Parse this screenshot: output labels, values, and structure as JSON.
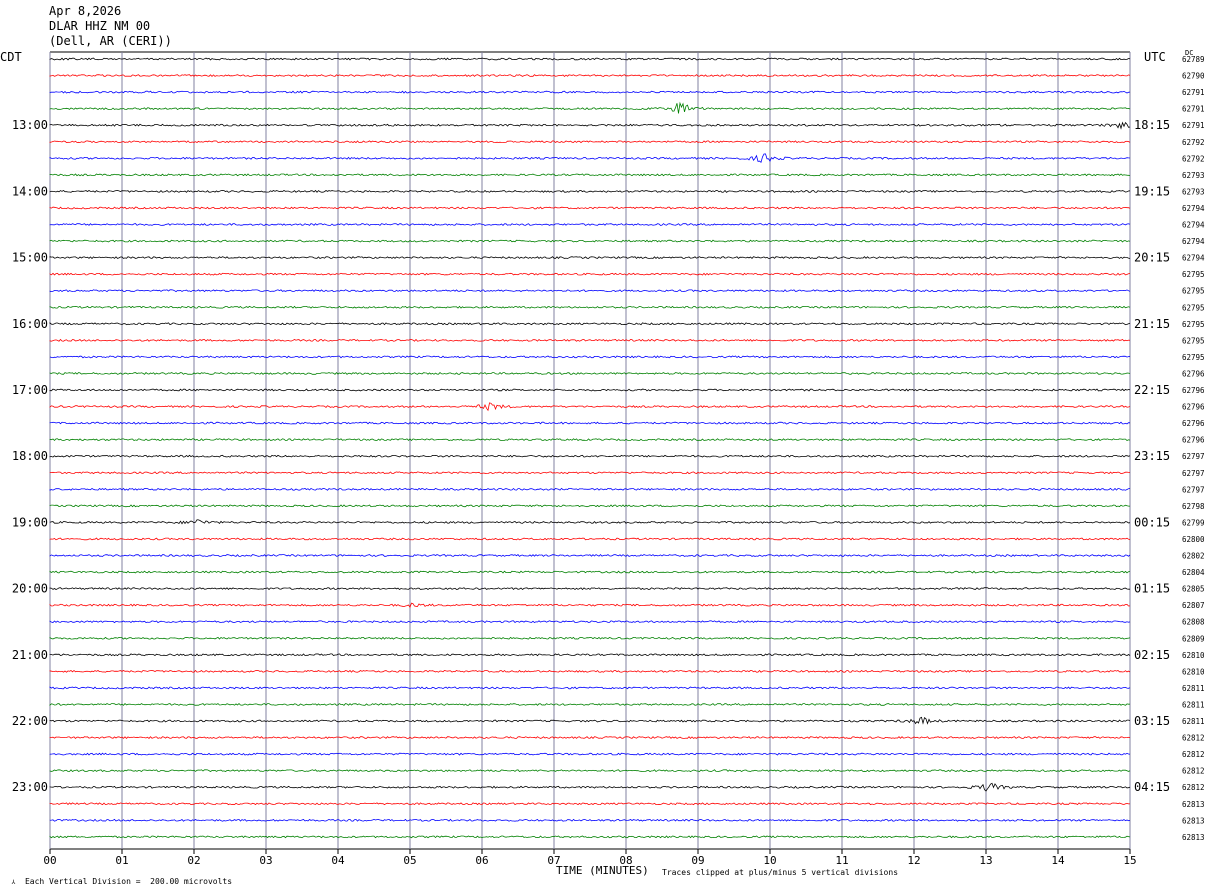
{
  "header": {
    "date": "Apr 8,2026",
    "station": "DLAR HHZ NM 00",
    "location": "(Dell, AR (CERI))"
  },
  "axes": {
    "left_label": "CDT",
    "right_label": "UTC",
    "dc_label": "DC",
    "x_title": "TIME (MINUTES)"
  },
  "footer": {
    "scale_text": "Each Vertical Division =  200.00 microvolts",
    "clip_text": "Traces clipped at plus/minus 5 vertical divisions"
  },
  "colors": {
    "trace_cycle": [
      "#000000",
      "#ff0000",
      "#0000ff",
      "#008000"
    ],
    "gridline": "#8080a0"
  },
  "chart_data": {
    "type": "line",
    "title": "",
    "xlabel": "TIME (MINUTES)",
    "xlim": [
      0,
      15
    ],
    "x_ticks": [
      "00",
      "01",
      "02",
      "03",
      "04",
      "05",
      "06",
      "07",
      "08",
      "09",
      "10",
      "11",
      "12",
      "13",
      "14",
      "15"
    ],
    "row_minutes": 15,
    "rows": 48,
    "left_time_labels": [
      "13:00",
      "14:00",
      "15:00",
      "16:00",
      "17:00",
      "18:00",
      "19:00",
      "20:00",
      "21:00",
      "22:00",
      "23:00"
    ],
    "right_time_labels": [
      "18:15",
      "19:15",
      "20:15",
      "21:15",
      "22:15",
      "23:15",
      "00:15",
      "01:15",
      "02:15",
      "03:15",
      "04:15"
    ],
    "hour_label_first_row": 4,
    "dc_offsets": [
      "62789",
      "62790",
      "62791",
      "62791",
      "62791",
      "62792",
      "62792",
      "62793",
      "62793",
      "62794",
      "62794",
      "62794",
      "62794",
      "62795",
      "62795",
      "62795",
      "62795",
      "62795",
      "62795",
      "62796",
      "62796",
      "62796",
      "62796",
      "62796",
      "62797",
      "62797",
      "62797",
      "62798",
      "62799",
      "62800",
      "62802",
      "62804",
      "62805",
      "62807",
      "62808",
      "62809",
      "62810",
      "62810",
      "62811",
      "62811",
      "62811",
      "62812",
      "62812",
      "62812",
      "62812",
      "62813",
      "62813",
      "62813"
    ],
    "events": [
      {
        "row": 3,
        "minute": 8.75,
        "amplitude": 7
      },
      {
        "row": 6,
        "minute": 9.92,
        "amplitude": 5
      },
      {
        "row": 21,
        "minute": 6.12,
        "amplitude": 4
      },
      {
        "row": 28,
        "minute": 2.05,
        "amplitude": 3
      },
      {
        "row": 40,
        "minute": 12.1,
        "amplitude": 4
      },
      {
        "row": 44,
        "minute": 13.05,
        "amplitude": 5
      },
      {
        "row": 4,
        "minute": 14.9,
        "amplitude": 3
      },
      {
        "row": 33,
        "minute": 5.05,
        "amplitude": 2
      }
    ]
  }
}
